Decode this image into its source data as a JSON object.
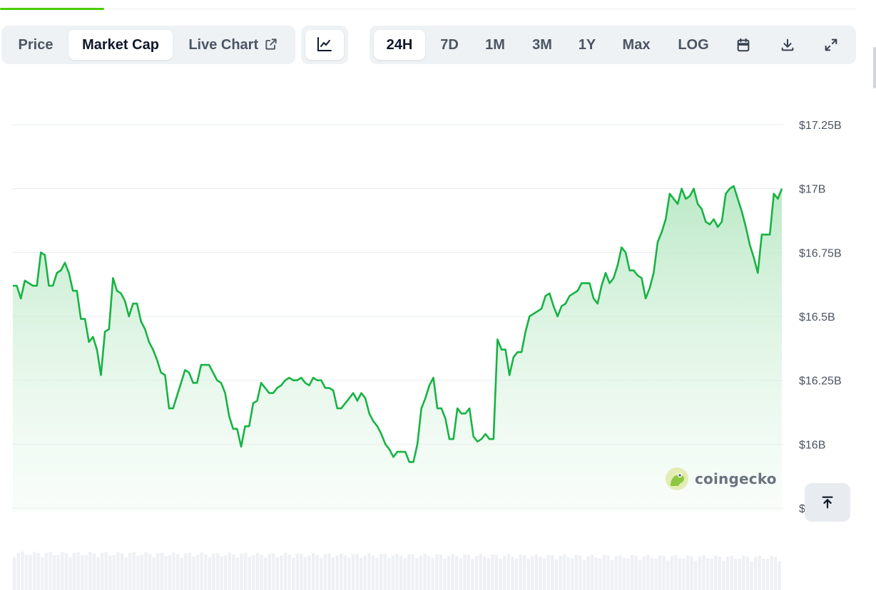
{
  "tabs": {
    "price": "Price",
    "market_cap": "Market Cap",
    "live_chart": "Live Chart",
    "active": "Market Cap"
  },
  "ranges": [
    "24H",
    "7D",
    "1M",
    "3M",
    "1Y",
    "Max",
    "LOG"
  ],
  "active_range": "24H",
  "icons": [
    "external-link-icon",
    "line-chart-icon",
    "calendar-icon",
    "download-icon",
    "expand-icon",
    "arrow-up-to-line-icon",
    "coingecko-logo-icon"
  ],
  "colors": {
    "line": "#16b343",
    "fill_top": "#b9e8c5",
    "accent": "#4bcc00",
    "grid": "#eaecef"
  },
  "watermark": "coingecko",
  "chart_data": {
    "type": "area",
    "title": "",
    "xlabel": "",
    "ylabel": "",
    "y_unit": "USD (billions)",
    "ylim": [
      15.75,
      17.25
    ],
    "y_ticks": [
      {
        "value": 17.25,
        "label": "$17.25B"
      },
      {
        "value": 17.0,
        "label": "$17B"
      },
      {
        "value": 16.75,
        "label": "$16.75B"
      },
      {
        "value": 16.5,
        "label": "$16.5B"
      },
      {
        "value": 16.25,
        "label": "$16.25B"
      },
      {
        "value": 16.0,
        "label": "$16B"
      },
      {
        "value": 15.75,
        "label": "$"
      }
    ],
    "grid": true,
    "legend": "none",
    "series": [
      {
        "values": [
          16.62,
          16.62,
          16.57,
          16.64,
          16.63,
          16.62,
          16.62,
          16.75,
          16.74,
          16.62,
          16.62,
          16.67,
          16.68,
          16.71,
          16.67,
          16.6,
          16.6,
          16.49,
          16.49,
          16.4,
          16.42,
          16.37,
          16.27,
          16.44,
          16.45,
          16.65,
          16.6,
          16.59,
          16.56,
          16.5,
          16.55,
          16.55,
          16.48,
          16.45,
          16.4,
          16.37,
          16.33,
          16.28,
          16.27,
          16.14,
          16.14,
          16.19,
          16.24,
          16.29,
          16.28,
          16.24,
          16.24,
          16.31,
          16.31,
          16.31,
          16.28,
          16.25,
          16.24,
          16.2,
          16.11,
          16.06,
          16.06,
          15.99,
          16.07,
          16.07,
          16.16,
          16.17,
          16.24,
          16.22,
          16.2,
          16.2,
          16.22,
          16.23,
          16.25,
          16.26,
          16.25,
          16.25,
          16.26,
          16.24,
          16.23,
          16.26,
          16.25,
          16.25,
          16.22,
          16.22,
          16.21,
          16.14,
          16.14,
          16.16,
          16.18,
          16.2,
          16.17,
          16.2,
          16.18,
          16.12,
          16.09,
          16.07,
          16.04,
          16.0,
          15.98,
          15.95,
          15.97,
          15.97,
          15.97,
          15.93,
          15.93,
          16.0,
          16.14,
          16.18,
          16.23,
          16.26,
          16.14,
          16.14,
          16.1,
          16.02,
          16.02,
          16.14,
          16.12,
          16.12,
          16.14,
          16.03,
          16.01,
          16.02,
          16.04,
          16.02,
          16.02,
          16.41,
          16.37,
          16.37,
          16.27,
          16.34,
          16.36,
          16.36,
          16.44,
          16.5,
          16.51,
          16.52,
          16.53,
          16.58,
          16.59,
          16.54,
          16.5,
          16.54,
          16.55,
          16.58,
          16.59,
          16.6,
          16.63,
          16.63,
          16.63,
          16.57,
          16.55,
          16.62,
          16.67,
          16.63,
          16.65,
          16.7,
          16.77,
          16.75,
          16.68,
          16.68,
          16.66,
          16.65,
          16.57,
          16.61,
          16.67,
          16.79,
          16.83,
          16.88,
          16.98,
          16.96,
          16.94,
          17.0,
          16.96,
          16.97,
          17.0,
          16.94,
          16.92,
          16.87,
          16.86,
          16.88,
          16.85,
          16.87,
          16.98,
          17.0,
          17.01,
          16.96,
          16.91,
          16.85,
          16.78,
          16.73,
          16.67,
          16.82,
          16.82,
          16.82,
          16.98,
          16.96,
          17.0
        ]
      }
    ],
    "volume_bars": true
  }
}
